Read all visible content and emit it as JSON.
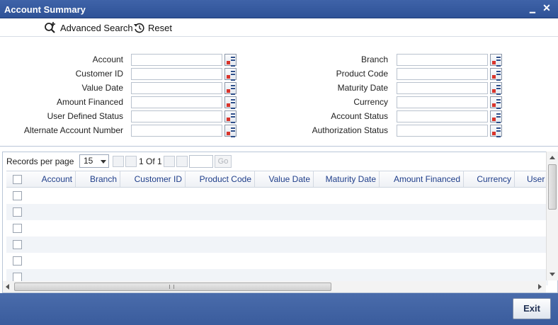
{
  "window": {
    "title": "Account Summary",
    "minimize_glyph": "▁",
    "close_glyph": "✕"
  },
  "toolbar": {
    "advanced_search_label": "Advanced Search",
    "reset_label": "Reset"
  },
  "search_fields": {
    "left": [
      {
        "label": "Account",
        "value": ""
      },
      {
        "label": "Customer ID",
        "value": ""
      },
      {
        "label": "Value Date",
        "value": ""
      },
      {
        "label": "Amount Financed",
        "value": ""
      },
      {
        "label": "User Defined Status",
        "value": ""
      },
      {
        "label": "Alternate Account Number",
        "value": ""
      }
    ],
    "right": [
      {
        "label": "Branch",
        "value": ""
      },
      {
        "label": "Product Code",
        "value": ""
      },
      {
        "label": "Maturity Date",
        "value": ""
      },
      {
        "label": "Currency",
        "value": ""
      },
      {
        "label": "Account Status",
        "value": ""
      },
      {
        "label": "Authorization Status",
        "value": ""
      }
    ]
  },
  "pager": {
    "records_per_page_label": "Records per page",
    "records_per_page_value": "15",
    "page_text": "1 Of 1",
    "page_input_value": "",
    "go_label": "Go"
  },
  "table": {
    "columns": [
      "Account",
      "Branch",
      "Customer ID",
      "Product Code",
      "Value Date",
      "Maturity Date",
      "Amount Financed",
      "Currency",
      "User"
    ],
    "rows": [
      "",
      "",
      "",
      "",
      "",
      ""
    ]
  },
  "footer": {
    "exit_label": "Exit"
  },
  "icons": {
    "advanced_search": "magnifier-plus-icon",
    "reset": "undo-arrow-icon",
    "lov": "list-of-values-icon"
  }
}
